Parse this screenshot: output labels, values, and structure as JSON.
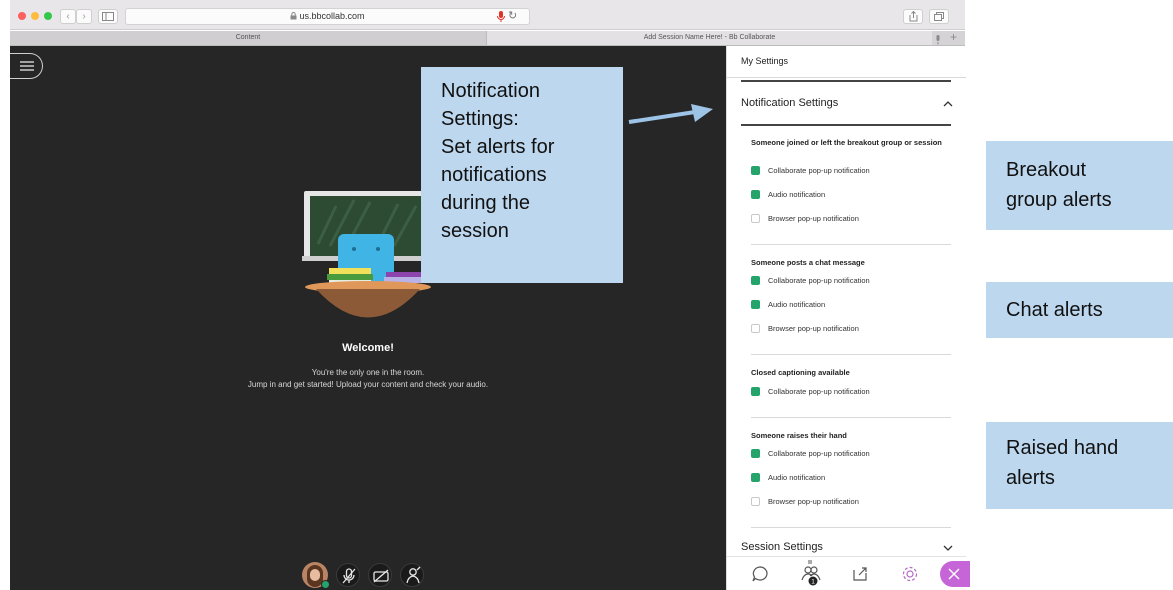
{
  "browser": {
    "url": "us.bbcollab.com",
    "tabs": [
      {
        "label": "Content"
      },
      {
        "label": "Add Session Name Here! - Bb Collaborate"
      }
    ]
  },
  "main": {
    "welcome_title": "Welcome!",
    "welcome_line1": "You're the only one in the room.",
    "welcome_line2": "Jump in and get started! Upload your content and check your audio."
  },
  "panel": {
    "title": "My Settings",
    "notification_section": "Notification Settings",
    "groups": [
      {
        "title": "Someone joined or left the breakout group or session",
        "options": [
          {
            "label": "Collaborate pop-up notification",
            "checked": true
          },
          {
            "label": "Audio notification",
            "checked": true
          },
          {
            "label": "Browser pop-up notification",
            "checked": false
          }
        ]
      },
      {
        "title": "Someone posts a chat message",
        "options": [
          {
            "label": "Collaborate pop-up notification",
            "checked": true
          },
          {
            "label": "Audio notification",
            "checked": true
          },
          {
            "label": "Browser pop-up notification",
            "checked": false
          }
        ]
      },
      {
        "title": "Closed captioning available",
        "options": [
          {
            "label": "Collaborate pop-up notification",
            "checked": true
          }
        ]
      },
      {
        "title": "Someone raises their hand",
        "options": [
          {
            "label": "Collaborate pop-up notification",
            "checked": true
          },
          {
            "label": "Audio notification",
            "checked": true
          },
          {
            "label": "Browser pop-up notification",
            "checked": false
          }
        ]
      }
    ],
    "session_section": "Session Settings",
    "attendee_badge": "1"
  },
  "callouts": {
    "notification": [
      "Notification",
      "Settings:",
      "Set alerts for",
      "notifications",
      "during the",
      "session"
    ],
    "breakout": [
      "Breakout",
      "group alerts"
    ],
    "chat": [
      "Chat alerts"
    ],
    "raise": [
      "Raised hand",
      "alerts"
    ]
  },
  "colors": {
    "callout_bg": "#bdd7ee",
    "checkbox_on": "#24a36b",
    "main_bg": "#262626",
    "close_button": "#c565d8",
    "arrow": "#9dc3e6"
  }
}
